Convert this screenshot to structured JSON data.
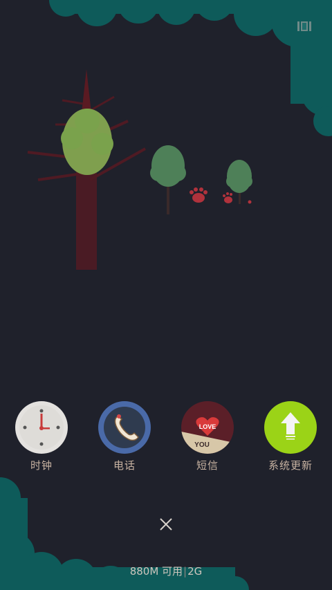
{
  "apps": [
    {
      "label": "时钟",
      "icon": "clock-icon"
    },
    {
      "label": "电话",
      "icon": "phone-icon"
    },
    {
      "label": "短信",
      "icon": "messages-icon"
    },
    {
      "label": "系统更新",
      "icon": "system-update-icon"
    }
  ],
  "sms_badge": {
    "line1": "LOVE",
    "line2": "YOU"
  },
  "memory": {
    "amount": "880M 可用",
    "separator": "|",
    "network": "2G"
  },
  "colors": {
    "background": "#1f212b",
    "foliage": "#0e5b5a",
    "label_text": "#c8b3a2",
    "update_green": "#9bd317"
  }
}
